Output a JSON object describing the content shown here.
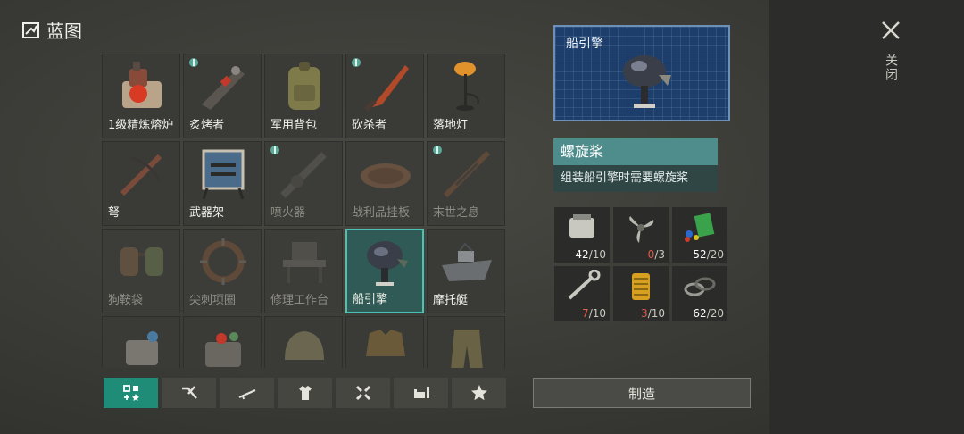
{
  "header": {
    "title": "蓝图",
    "close_label": "关闭"
  },
  "grid": {
    "items": [
      {
        "label": "1级精炼熔炉",
        "state": "available"
      },
      {
        "label": "炙烤者",
        "state": "available",
        "badge": true
      },
      {
        "label": "军用背包",
        "state": "available"
      },
      {
        "label": "砍杀者",
        "state": "available",
        "badge": true
      },
      {
        "label": "落地灯",
        "state": "available"
      },
      {
        "label": "弩",
        "state": "available"
      },
      {
        "label": "武器架",
        "state": "available"
      },
      {
        "label": "喷火器",
        "state": "locked",
        "badge": true
      },
      {
        "label": "战利品挂板",
        "state": "locked"
      },
      {
        "label": "末世之息",
        "state": "locked",
        "badge": true
      },
      {
        "label": "狗鞍袋",
        "state": "locked"
      },
      {
        "label": "尖刺项圈",
        "state": "locked"
      },
      {
        "label": "修理工作台",
        "state": "locked"
      },
      {
        "label": "船引擎",
        "state": "selected"
      },
      {
        "label": "摩托艇",
        "state": "available"
      }
    ]
  },
  "tabs": [
    {
      "icon": "blueprint-grid-icon",
      "active": true
    },
    {
      "icon": "tools-icon",
      "active": false
    },
    {
      "icon": "rifle-icon",
      "active": false
    },
    {
      "icon": "shirt-icon",
      "active": false
    },
    {
      "icon": "wrench-cross-icon",
      "active": false
    },
    {
      "icon": "furniture-icon",
      "active": false
    },
    {
      "icon": "star-icon",
      "active": false
    }
  ],
  "detail": {
    "blueprint_title": "船引擎",
    "tooltip_title": "螺旋桨",
    "tooltip_desc": "组装船引擎时需要螺旋桨"
  },
  "materials": [
    {
      "icon": "engine-block-icon",
      "have": "42",
      "need": "/10",
      "enough": true
    },
    {
      "icon": "propeller-icon",
      "have": "0",
      "need": "/3",
      "enough": false
    },
    {
      "icon": "plastic-parts-icon",
      "have": "52",
      "need": "/20",
      "enough": true
    },
    {
      "icon": "wrench-icon",
      "have": "7",
      "need": "/10",
      "enough": false
    },
    {
      "icon": "oil-filter-icon",
      "have": "3",
      "need": "/10",
      "enough": false
    },
    {
      "icon": "rubber-gasket-icon",
      "have": "62",
      "need": "/20",
      "enough": true
    }
  ],
  "craft_button": "制造",
  "colors": {
    "accent": "#1f8c78",
    "selected_border": "#4bc2b2",
    "insufficient": "#e25a48",
    "blueprint_bg": "#1d3e6a"
  }
}
